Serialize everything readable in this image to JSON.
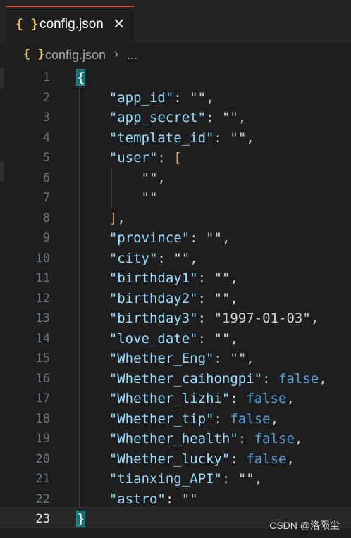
{
  "tab": {
    "icon": "{ }",
    "filename": "config.json",
    "close": "✕"
  },
  "breadcrumb": {
    "icon": "{ }",
    "filename": "config.json",
    "separator": "›",
    "more": "..."
  },
  "editor": {
    "active_line": "23",
    "lines": [
      {
        "n": "1"
      },
      {
        "n": "2"
      },
      {
        "n": "3"
      },
      {
        "n": "4"
      },
      {
        "n": "5"
      },
      {
        "n": "6"
      },
      {
        "n": "7"
      },
      {
        "n": "8"
      },
      {
        "n": "9"
      },
      {
        "n": "10"
      },
      {
        "n": "11"
      },
      {
        "n": "12"
      },
      {
        "n": "13"
      },
      {
        "n": "14"
      },
      {
        "n": "15"
      },
      {
        "n": "16"
      },
      {
        "n": "17"
      },
      {
        "n": "18"
      },
      {
        "n": "19"
      },
      {
        "n": "20"
      },
      {
        "n": "21"
      },
      {
        "n": "22"
      },
      {
        "n": "23"
      }
    ],
    "code": {
      "open": "{",
      "app_id_key": "\"app_id\"",
      "app_id_val": "\"\"",
      "app_secret_key": "\"app_secret\"",
      "app_secret_val": "\"\"",
      "template_id_key": "\"template_id\"",
      "template_id_val": "\"\"",
      "user_key": "\"user\"",
      "user_open": "[",
      "user_item1": "\"\"",
      "user_item2": "\"\"",
      "user_close": "]",
      "province_key": "\"province\"",
      "province_val": "\"\"",
      "city_key": "\"city\"",
      "city_val": "\"\"",
      "birthday1_key": "\"birthday1\"",
      "birthday1_val": "\"\"",
      "birthday2_key": "\"birthday2\"",
      "birthday2_val": "\"\"",
      "birthday3_key": "\"birthday3\"",
      "birthday3_val": "\"1997-01-03\"",
      "love_date_key": "\"love_date\"",
      "love_date_val": "\"\"",
      "eng_key": "\"Whether_Eng\"",
      "eng_val": "\"\"",
      "caihongpi_key": "\"Whether_caihongpi\"",
      "caihongpi_val": "false",
      "lizhi_key": "\"Whether_lizhi\"",
      "lizhi_val": "false",
      "tip_key": "\"Whether_tip\"",
      "tip_val": "false",
      "health_key": "\"Whether_health\"",
      "health_val": "false",
      "lucky_key": "\"Whether_lucky\"",
      "lucky_val": "false",
      "tianxing_key": "\"tianxing_API\"",
      "tianxing_val": "\"\"",
      "astro_key": "\"astro\"",
      "astro_val": "\"\"",
      "close": "}"
    }
  },
  "watermark": "CSDN @洛陨尘"
}
